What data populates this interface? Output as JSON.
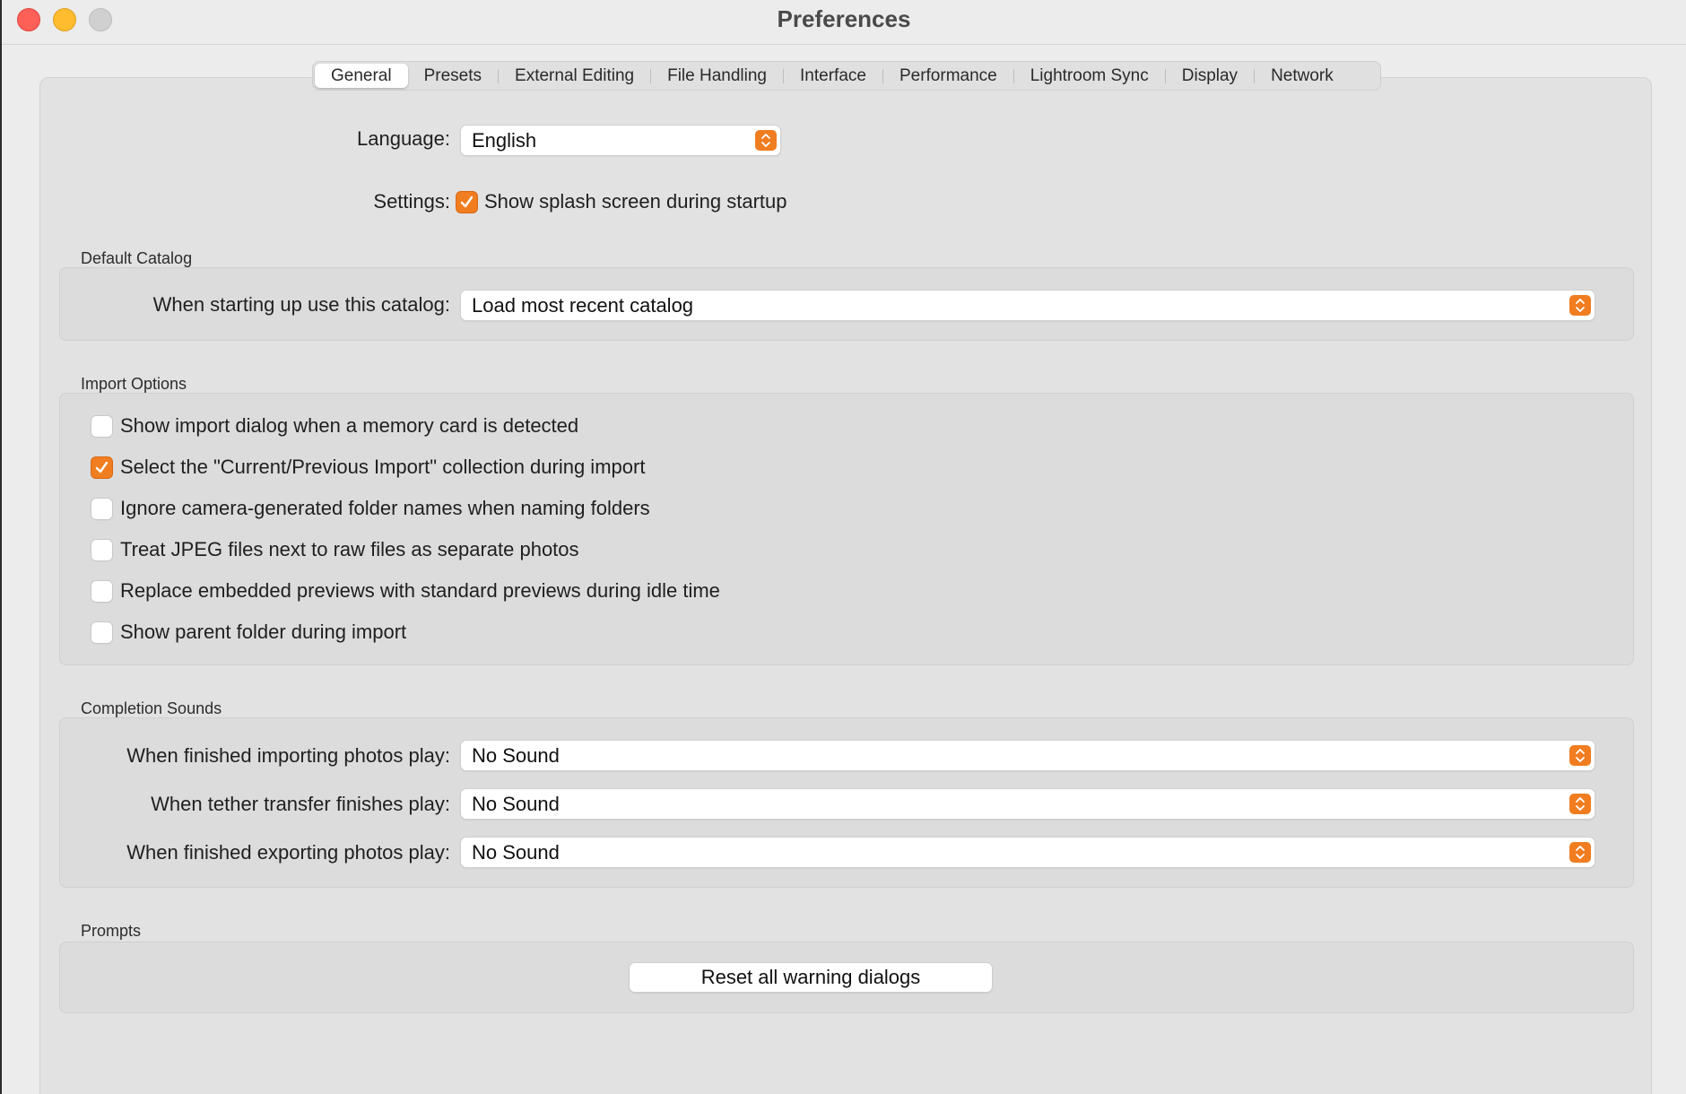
{
  "window": {
    "title": "Preferences"
  },
  "tabs": [
    {
      "label": "General",
      "active": true
    },
    {
      "label": "Presets",
      "active": false
    },
    {
      "label": "External Editing",
      "active": false
    },
    {
      "label": "File Handling",
      "active": false
    },
    {
      "label": "Interface",
      "active": false
    },
    {
      "label": "Performance",
      "active": false
    },
    {
      "label": "Lightroom Sync",
      "active": false
    },
    {
      "label": "Display",
      "active": false
    },
    {
      "label": "Network",
      "active": false
    }
  ],
  "general": {
    "language_label": "Language:",
    "language_value": "English",
    "settings_label": "Settings:",
    "splash_label": "Show splash screen during startup",
    "splash_checked": true
  },
  "default_catalog": {
    "title": "Default Catalog",
    "label": "When starting up use this catalog:",
    "value": "Load most recent catalog"
  },
  "import_options": {
    "title": "Import Options",
    "items": [
      {
        "label": "Show import dialog when a memory card is detected",
        "checked": false
      },
      {
        "label": "Select the \"Current/Previous Import\" collection during import",
        "checked": true
      },
      {
        "label": "Ignore camera-generated folder names when naming folders",
        "checked": false
      },
      {
        "label": "Treat JPEG files next to raw files as separate photos",
        "checked": false
      },
      {
        "label": "Replace embedded previews with standard previews during idle time",
        "checked": false
      },
      {
        "label": "Show parent folder during import",
        "checked": false
      }
    ]
  },
  "completion_sounds": {
    "title": "Completion Sounds",
    "rows": [
      {
        "label": "When finished importing photos play:",
        "value": "No Sound"
      },
      {
        "label": "When tether transfer finishes play:",
        "value": "No Sound"
      },
      {
        "label": "When finished exporting photos play:",
        "value": "No Sound"
      }
    ]
  },
  "prompts": {
    "title": "Prompts",
    "reset_button": "Reset all warning dialogs"
  },
  "colors": {
    "accent": "#f07d20",
    "close": "#fe5f57",
    "minimize": "#febc2e",
    "zoom_disabled": "#d0d0d0"
  },
  "icons": {
    "stepper": "up-down-chevron-icon",
    "check": "checkmark-icon"
  }
}
